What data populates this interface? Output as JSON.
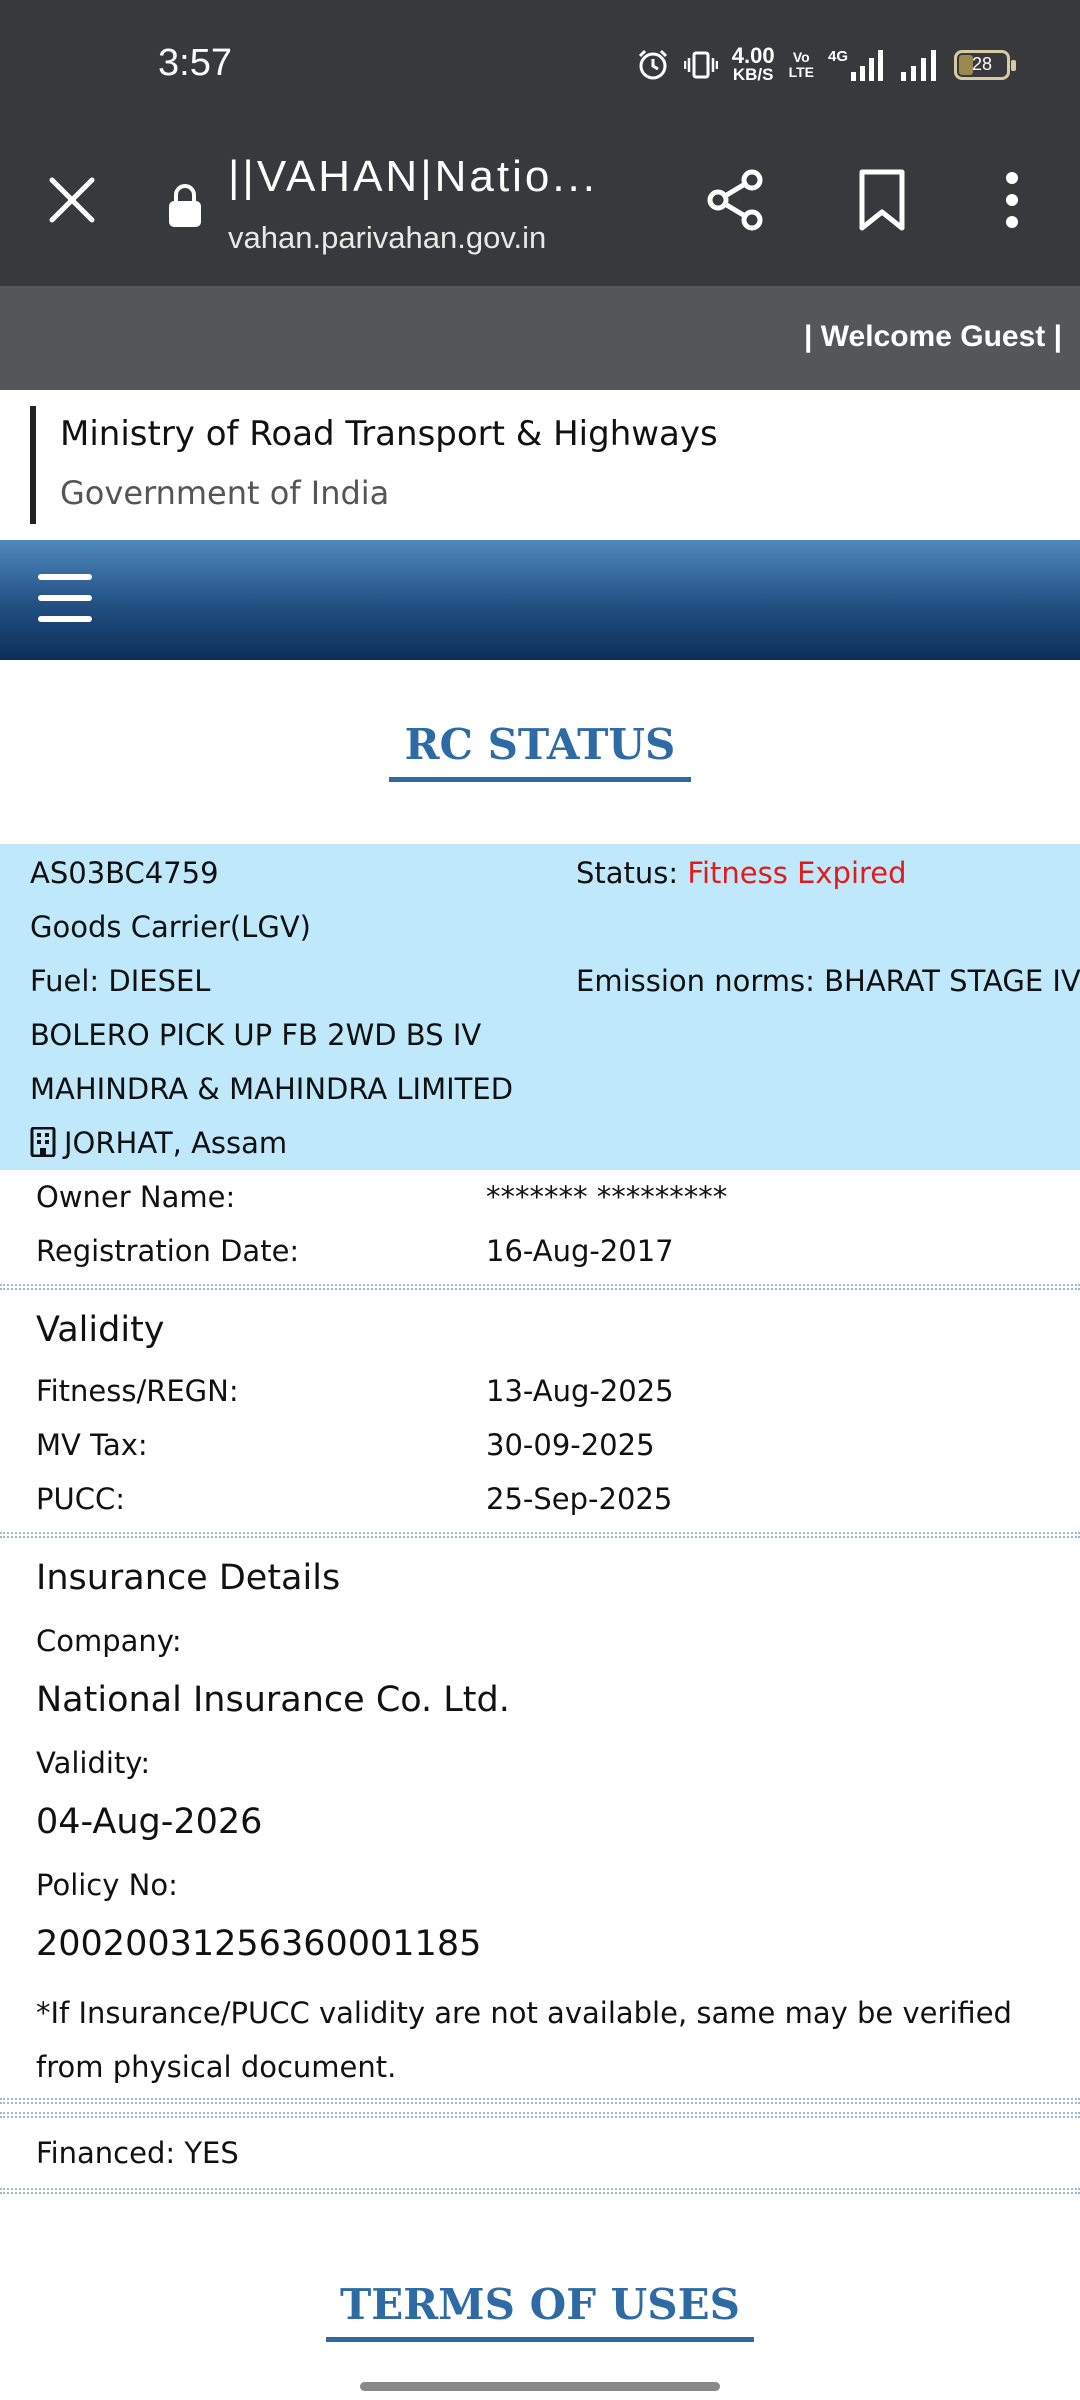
{
  "status_bar": {
    "time": "3:57",
    "net_speed_value": "4.00",
    "net_speed_unit": "KB/S",
    "volte_top": "Vo",
    "volte_bottom": "LTE",
    "network_type": "4G",
    "battery_level": "28",
    "battery_fraction": 0.28
  },
  "browser": {
    "page_title": "||VAHAN|Natio...",
    "url": "vahan.parivahan.gov.in"
  },
  "header": {
    "welcome": "| Welcome Guest |",
    "ministry": "Ministry of Road Transport & Highways",
    "government": "Government of India"
  },
  "rc": {
    "title": "RC STATUS",
    "registration_no": "AS03BC4759",
    "status_label": "Status:",
    "status_value": "Fitness Expired",
    "vehicle_class": "Goods Carrier(LGV)",
    "fuel": "Fuel: DIESEL",
    "emission": "Emission norms: BHARAT STAGE IV",
    "model": "BOLERO PICK UP FB 2WD BS IV",
    "maker": "MAHINDRA & MAHINDRA LIMITED",
    "location": "JORHAT, Assam",
    "owner_label": "Owner Name:",
    "owner_value": "******* *********",
    "reg_date_label": "Registration Date:",
    "reg_date_value": "16-Aug-2017"
  },
  "validity": {
    "title": "Validity",
    "fitness_label": "Fitness/REGN:",
    "fitness_value": "13-Aug-2025",
    "tax_label": "MV Tax:",
    "tax_value": "30-09-2025",
    "pucc_label": "PUCC:",
    "pucc_value": "25-Sep-2025"
  },
  "insurance": {
    "title": "Insurance Details",
    "company_label": "Company:",
    "company_value": "National Insurance Co. Ltd.",
    "validity_label": "Validity:",
    "validity_value": "04-Aug-2026",
    "policy_label": "Policy No:",
    "policy_value": "20020031256360001185",
    "note": "*If Insurance/PUCC validity are not available, same may be verified from physical document."
  },
  "financed": "Financed: YES",
  "terms_title": "TERMS OF USES",
  "colors": {
    "status_red": "#e01b1b",
    "date_blue": "#1b24c4",
    "title_blue": "#2e6aa3",
    "info_box": "#bfe8fb"
  }
}
